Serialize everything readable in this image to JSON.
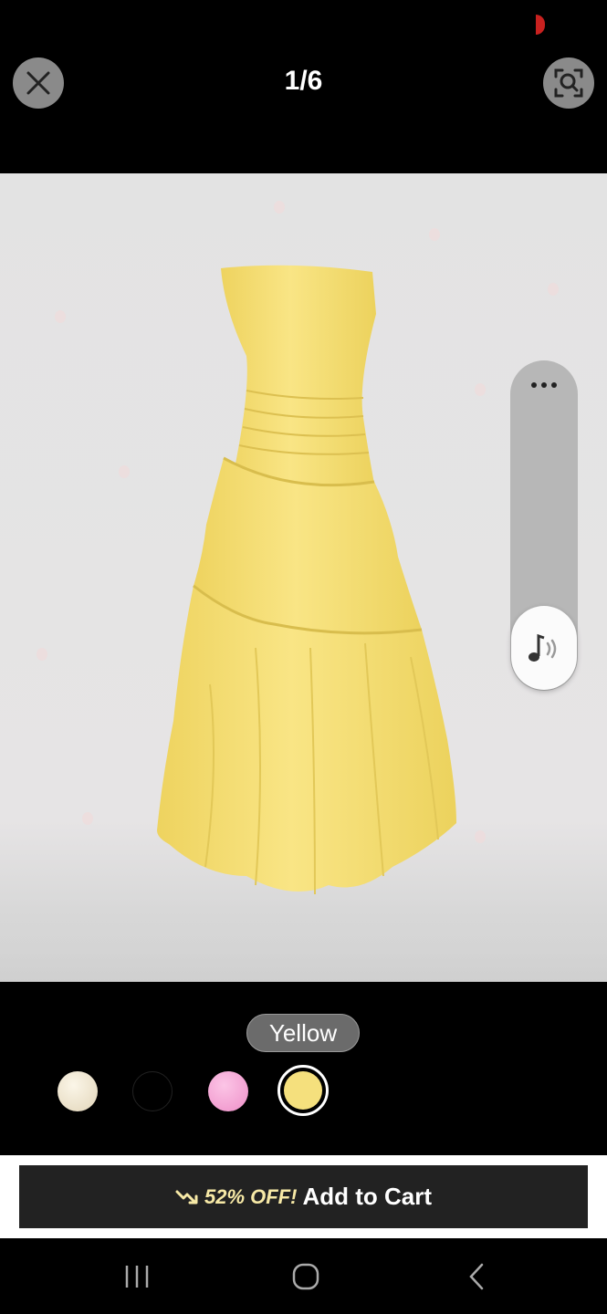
{
  "header": {
    "image_counter": "1/6",
    "close_icon": "close-icon",
    "zoom_icon": "image-search-icon",
    "recording_indicator_color": "#c8211f"
  },
  "product_image": {
    "subject": "yellow strapless tiered midi dress",
    "dress_color": "#f6e27a",
    "background_color": "#e4e3e4"
  },
  "side_panel": {
    "more_icon": "more-horizontal-icon",
    "music_icon": "music-note-icon"
  },
  "colors": {
    "selected_label": "Yellow",
    "options": [
      {
        "name": "cream",
        "hex": "#efe6d2"
      },
      {
        "name": "black",
        "hex": "#000000"
      },
      {
        "name": "pink",
        "hex": "#f5a8d8"
      },
      {
        "name": "yellow",
        "hex": "#f5e07d",
        "selected": true
      }
    ]
  },
  "cart": {
    "trend_icon": "trending-down-icon",
    "discount_text": "52% OFF!",
    "label": "Add to Cart"
  },
  "nav": {
    "recent_icon": "recent-apps-icon",
    "home_icon": "home-icon",
    "back_icon": "back-icon"
  }
}
